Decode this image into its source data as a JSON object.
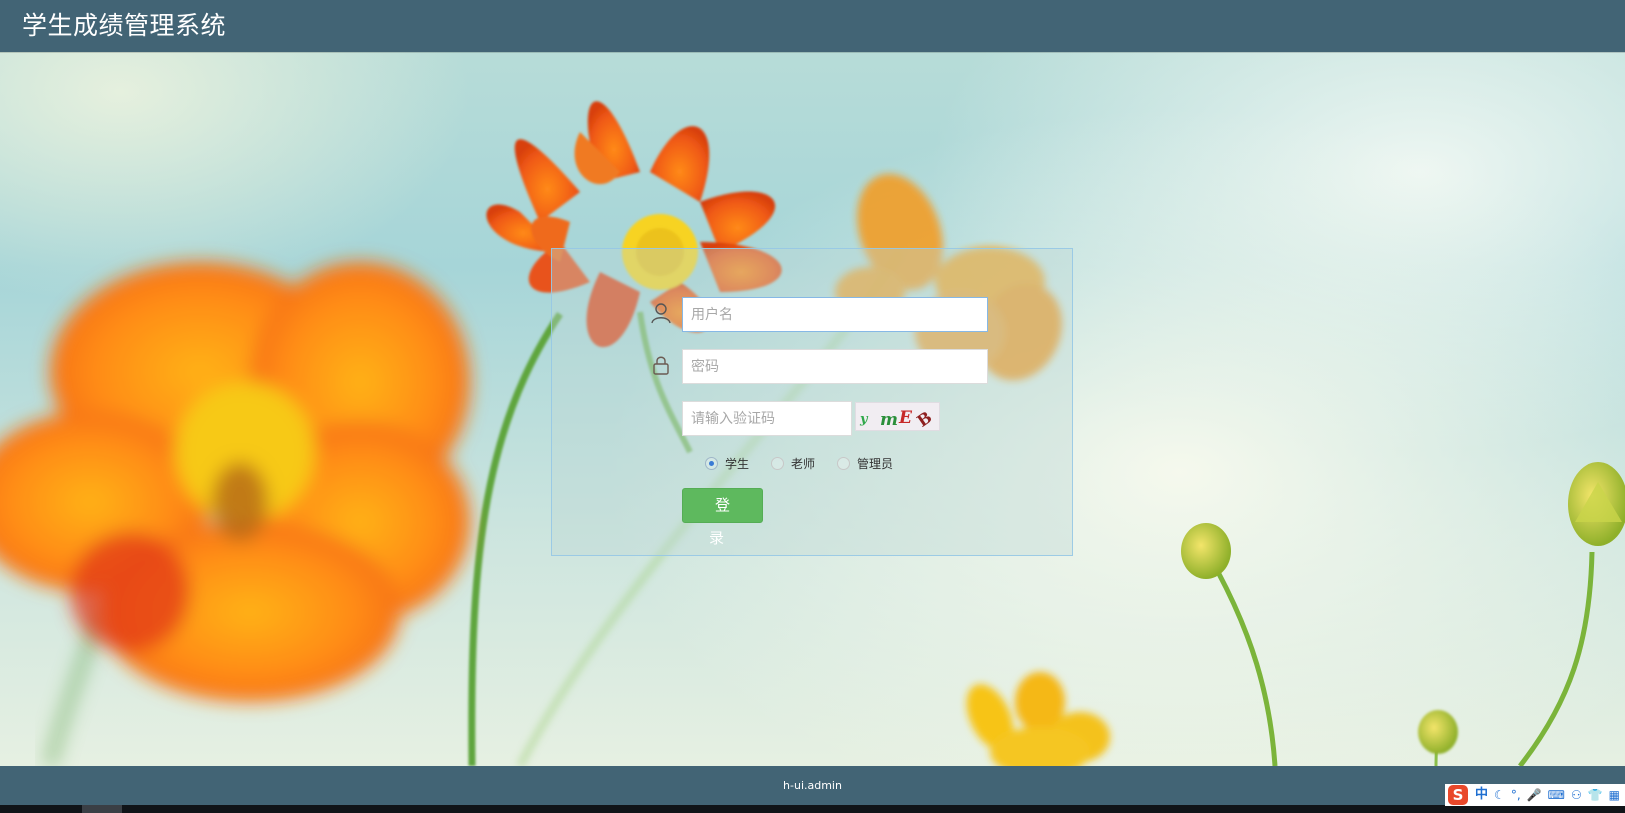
{
  "header": {
    "title": "学生成绩管理系统"
  },
  "login": {
    "username_placeholder": "用户名",
    "password_placeholder": "密码",
    "captcha_placeholder": "请输入验证码",
    "captcha_text": "ymE",
    "roles": [
      {
        "label": "学生",
        "checked": true
      },
      {
        "label": "老师",
        "checked": false
      },
      {
        "label": "管理员",
        "checked": false
      }
    ],
    "submit_label": "登 录"
  },
  "footer": {
    "text": "h-ui.admin"
  },
  "ime": {
    "logo": "S",
    "items": [
      {
        "label": "中",
        "icon": "chinese-mode-icon"
      },
      {
        "label": "☾",
        "icon": "half-width-icon"
      },
      {
        "label": "°,",
        "icon": "punctuation-icon"
      },
      {
        "label": "🎤",
        "icon": "microphone-icon"
      },
      {
        "label": "⌨",
        "icon": "keyboard-icon"
      },
      {
        "label": "⚇",
        "icon": "user-icon"
      },
      {
        "label": "👕",
        "icon": "skin-icon"
      },
      {
        "label": "▦",
        "icon": "toolbox-icon"
      }
    ]
  },
  "colors": {
    "header_bg": "#426475",
    "login_button": "#5eb95e",
    "accent": "#3a7bd5"
  }
}
